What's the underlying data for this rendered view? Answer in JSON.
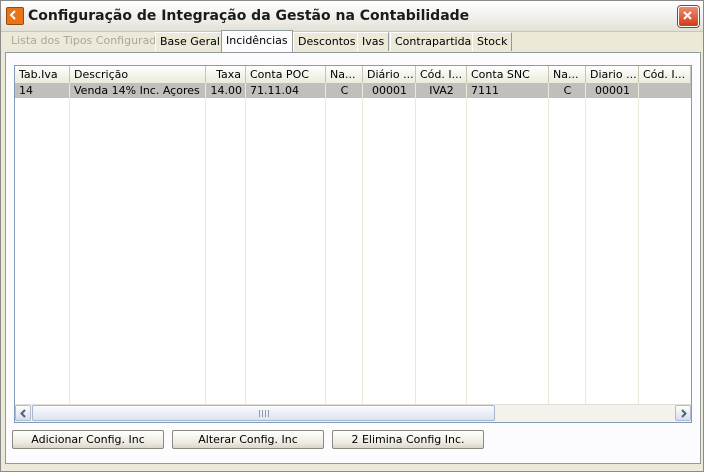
{
  "window": {
    "title": "Configuração de Integração da Gestão na Contabilidade"
  },
  "tabs": [
    {
      "label": "Lista dos Tipos Configurados",
      "state": "disabled"
    },
    {
      "label": "Base Geral",
      "state": "normal"
    },
    {
      "label": "Incidências",
      "state": "active"
    },
    {
      "label": "Descontos",
      "state": "normal"
    },
    {
      "label": "Ivas",
      "state": "normal"
    },
    {
      "label": "Contrapartidas",
      "state": "normal"
    },
    {
      "label": "Stock",
      "state": "normal"
    }
  ],
  "grid": {
    "columns": [
      "Tab.Iva",
      "Descrição",
      "Taxa",
      "Conta POC",
      "Na...",
      "Diário ...",
      "Cód. I...",
      "Conta SNC",
      "Na...",
      "Diario ...",
      "Cód. I..."
    ],
    "rows": [
      [
        "14",
        "Venda 14% Inc. Açores",
        "14.00",
        "71.11.04",
        "C",
        "00001",
        "IVA2",
        "7111",
        "C",
        "00001",
        ""
      ]
    ],
    "scroll_grip": "III"
  },
  "buttons": {
    "add": "Adicionar Config. Inc",
    "edit": "Alterar Config. Inc",
    "delete": "2 Elimina Config Inc."
  },
  "icons": {
    "app": "app-back-icon",
    "close": "close-icon",
    "left": "arrow-left-icon",
    "right": "arrow-right-icon"
  }
}
